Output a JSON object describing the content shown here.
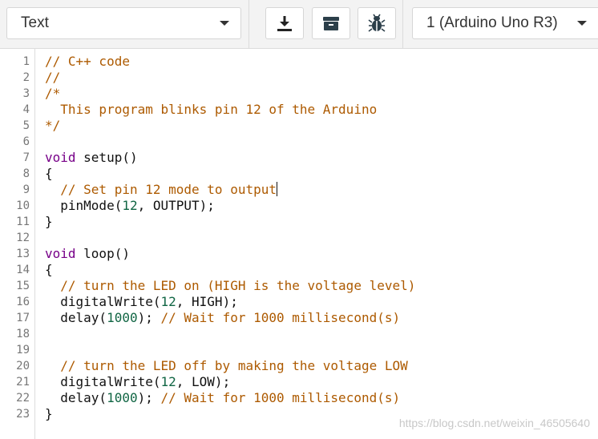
{
  "toolbar": {
    "mode_select": {
      "value": "Text"
    },
    "download_icon": "download-icon",
    "library_icon": "library-icon",
    "debugger_icon": "bug-icon",
    "device_select": {
      "value": "1 (Arduino Uno R3)"
    }
  },
  "editor": {
    "lines": [
      {
        "n": "1",
        "tokens": [
          {
            "t": "// C++ code",
            "k": "comment"
          }
        ]
      },
      {
        "n": "2",
        "tokens": [
          {
            "t": "//",
            "k": "comment"
          }
        ]
      },
      {
        "n": "3",
        "tokens": [
          {
            "t": "/*",
            "k": "comment"
          }
        ]
      },
      {
        "n": "4",
        "tokens": [
          {
            "t": "  This program blinks pin 12 of the Arduino",
            "k": "comment"
          }
        ]
      },
      {
        "n": "5",
        "tokens": [
          {
            "t": "*/",
            "k": "comment"
          }
        ]
      },
      {
        "n": "6",
        "tokens": []
      },
      {
        "n": "7",
        "tokens": [
          {
            "t": "void",
            "k": "keyword"
          },
          {
            "t": " setup()",
            "k": "plain"
          }
        ]
      },
      {
        "n": "8",
        "tokens": [
          {
            "t": "{",
            "k": "plain"
          }
        ]
      },
      {
        "n": "9",
        "tokens": [
          {
            "t": "  ",
            "k": "plain"
          },
          {
            "t": "// Set pin 12 mode to output",
            "k": "comment"
          }
        ],
        "cursor_after": true
      },
      {
        "n": "10",
        "tokens": [
          {
            "t": "  pinMode(",
            "k": "plain"
          },
          {
            "t": "12",
            "k": "number"
          },
          {
            "t": ", OUTPUT);",
            "k": "plain"
          }
        ]
      },
      {
        "n": "11",
        "tokens": [
          {
            "t": "}",
            "k": "plain"
          }
        ]
      },
      {
        "n": "12",
        "tokens": []
      },
      {
        "n": "13",
        "tokens": [
          {
            "t": "void",
            "k": "keyword"
          },
          {
            "t": " loop()",
            "k": "plain"
          }
        ]
      },
      {
        "n": "14",
        "tokens": [
          {
            "t": "{",
            "k": "plain"
          }
        ]
      },
      {
        "n": "15",
        "tokens": [
          {
            "t": "  ",
            "k": "plain"
          },
          {
            "t": "// turn the LED on (HIGH is the voltage level)",
            "k": "comment"
          }
        ]
      },
      {
        "n": "16",
        "tokens": [
          {
            "t": "  digitalWrite(",
            "k": "plain"
          },
          {
            "t": "12",
            "k": "number"
          },
          {
            "t": ", HIGH);",
            "k": "plain"
          }
        ]
      },
      {
        "n": "17",
        "tokens": [
          {
            "t": "  delay(",
            "k": "plain"
          },
          {
            "t": "1000",
            "k": "number"
          },
          {
            "t": "); ",
            "k": "plain"
          },
          {
            "t": "// Wait for 1000 millisecond(s)",
            "k": "comment"
          }
        ]
      },
      {
        "n": "18",
        "tokens": []
      },
      {
        "n": "19",
        "tokens": []
      },
      {
        "n": "20",
        "tokens": [
          {
            "t": "  ",
            "k": "plain"
          },
          {
            "t": "// turn the LED off by making the voltage LOW",
            "k": "comment"
          }
        ]
      },
      {
        "n": "21",
        "tokens": [
          {
            "t": "  digitalWrite(",
            "k": "plain"
          },
          {
            "t": "12",
            "k": "number"
          },
          {
            "t": ", LOW);",
            "k": "plain"
          }
        ]
      },
      {
        "n": "22",
        "tokens": [
          {
            "t": "  delay(",
            "k": "plain"
          },
          {
            "t": "1000",
            "k": "number"
          },
          {
            "t": "); ",
            "k": "plain"
          },
          {
            "t": "// Wait for 1000 millisecond(s)",
            "k": "comment"
          }
        ]
      },
      {
        "n": "23",
        "tokens": [
          {
            "t": "}",
            "k": "plain"
          }
        ]
      }
    ]
  },
  "watermark": "https://blog.csdn.net/weixin_46505640",
  "colors": {
    "comment": "#ad5a00",
    "keyword": "#770088",
    "number": "#116644",
    "plain": "#111111"
  }
}
